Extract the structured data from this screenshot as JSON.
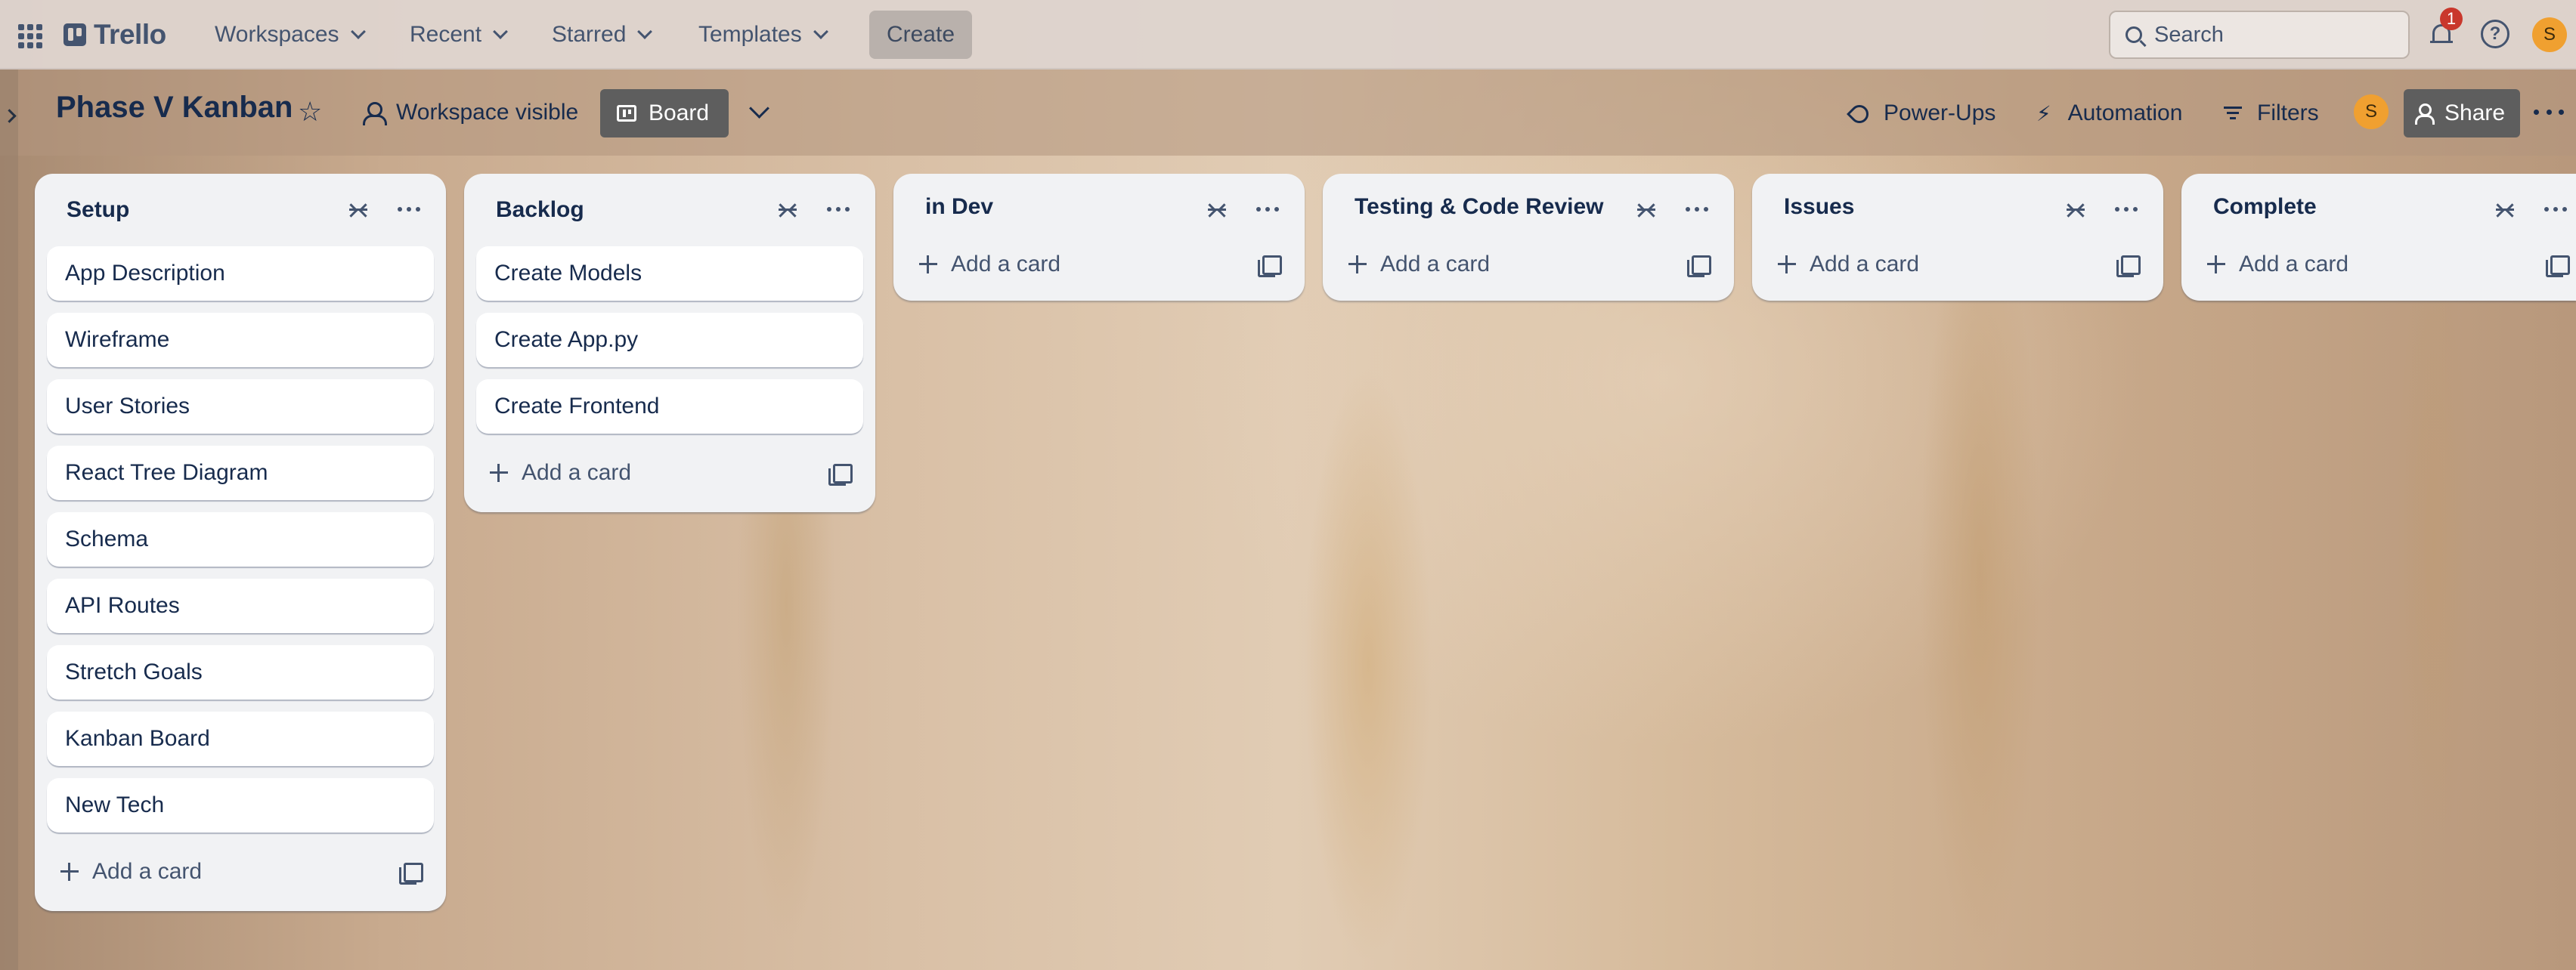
{
  "topbar": {
    "logo_text": "Trello",
    "nav": [
      {
        "label": "Workspaces"
      },
      {
        "label": "Recent"
      },
      {
        "label": "Starred"
      },
      {
        "label": "Templates"
      }
    ],
    "create_label": "Create",
    "search_placeholder": "Search",
    "notification_count": "1",
    "help_glyph": "?",
    "user_initial": "S",
    "icons": [
      "apps-grid-icon",
      "search-icon",
      "bell-icon",
      "help-icon"
    ]
  },
  "board": {
    "title": "Phase V Kanban",
    "star_glyph": "☆",
    "visibility_label": "Workspace visible",
    "view_label": "Board",
    "powerups_label": "Power-Ups",
    "automation_label": "Automation",
    "filters_label": "Filters",
    "member_initial": "S",
    "share_label": "Share"
  },
  "lists": [
    {
      "title": "Setup",
      "cards": [
        "App Description",
        "Wireframe",
        "User Stories",
        "React Tree Diagram",
        "Schema",
        "API Routes",
        "Stretch Goals",
        "Kanban Board",
        "New Tech"
      ],
      "add_label": "Add a card"
    },
    {
      "title": "Backlog",
      "cards": [
        "Create Models",
        "Create App.py",
        "Create Frontend"
      ],
      "add_label": "Add a card"
    },
    {
      "title": "in Dev",
      "cards": [],
      "add_label": "Add a card"
    },
    {
      "title": "Testing & Code Review",
      "cards": [],
      "add_label": "Add a card"
    },
    {
      "title": "Issues",
      "cards": [],
      "add_label": "Add a card"
    },
    {
      "title": "Complete",
      "cards": [],
      "add_label": "Add a card"
    }
  ],
  "colors": {
    "topbar_bg": "#ded4cd",
    "list_bg": "#f1f2f4",
    "card_bg": "#ffffff",
    "text": "#172b4d",
    "avatar": "#f0a030",
    "badge": "#c9372c",
    "dark_button": "#5e5e5e"
  }
}
